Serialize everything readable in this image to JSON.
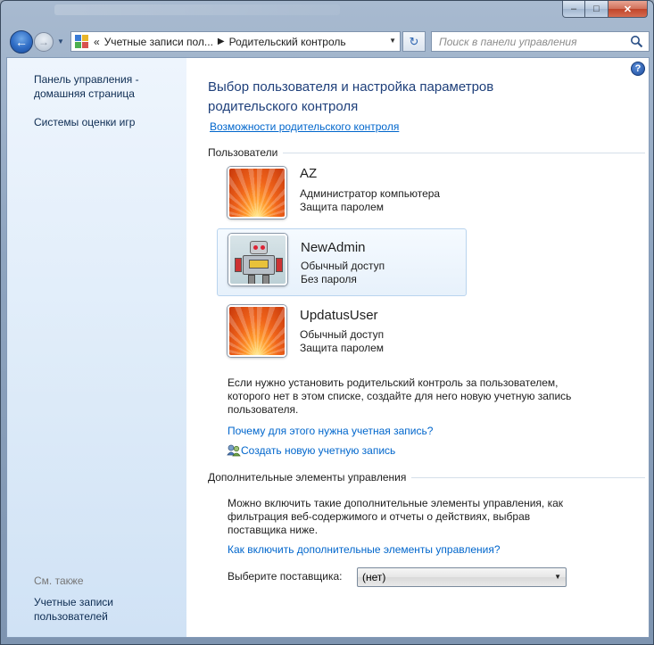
{
  "window": {
    "min_glyph": "–",
    "max_glyph": "□",
    "close_glyph": "✕"
  },
  "nav": {
    "back_glyph": "←",
    "forward_glyph": "→",
    "dropdown_glyph": "▼",
    "breadcrumb_overflow": "«",
    "breadcrumb": [
      "Учетные записи пол...",
      "Родительский контроль"
    ],
    "refresh_glyph": "↻",
    "search_placeholder": "Поиск в панели управления"
  },
  "sidebar": {
    "home_link": "Панель управления -\nдомашняя страница",
    "game_ratings": "Системы оценки игр",
    "see_also": "См. также",
    "user_accounts": "Учетные записи\nпользователей"
  },
  "main": {
    "help_glyph": "?",
    "heading": "Выбор пользователя и настройка параметров родительского контроля",
    "features_link": "Возможности родительского контроля",
    "users_header": "Пользователи",
    "users": [
      {
        "name": "AZ",
        "line1": "Администратор компьютера",
        "line2": "Защита паролем",
        "avatar": "flower"
      },
      {
        "name": "NewAdmin",
        "line1": "Обычный доступ",
        "line2": "Без пароля",
        "avatar": "robot"
      },
      {
        "name": "UpdatusUser",
        "line1": "Обычный доступ",
        "line2": "Защита паролем",
        "avatar": "flower"
      }
    ],
    "info_text": "Если нужно установить родительский контроль за пользователем, которого нет в этом списке, создайте для него новую учетную запись пользователя.",
    "why_link": "Почему для этого нужна учетная запись?",
    "create_link": "Создать новую учетную запись",
    "extra_header": "Дополнительные элементы управления",
    "extra_text": "Можно включить такие дополнительные элементы управления, как фильтрация веб-содержимого и отчеты о действиях, выбрав поставщика ниже.",
    "extra_link": "Как включить дополнительные элементы управления?",
    "provider_label": "Выберите поставщика:",
    "provider_value": "(нет)"
  },
  "colors": {
    "link": "#0066cc",
    "heading": "#1e3f7a",
    "sidebar_text": "#0d2c52"
  }
}
